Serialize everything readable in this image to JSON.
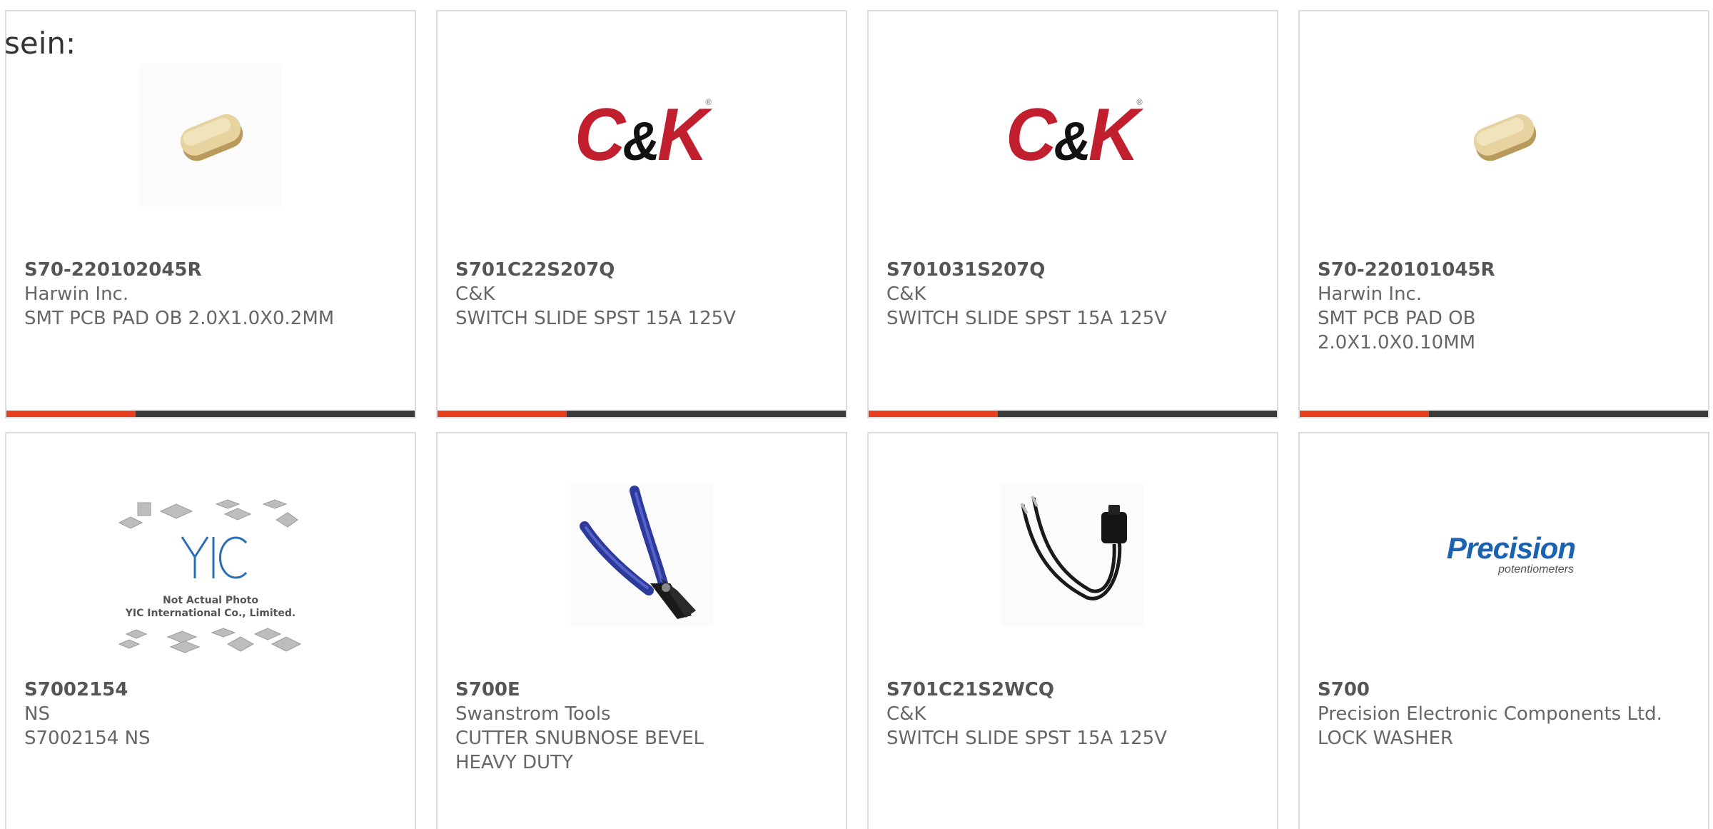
{
  "overlay_text": "sein:",
  "products": [
    {
      "part_number": "S70-220102045R",
      "manufacturer": "Harwin Inc.",
      "description": "SMT PCB PAD OB 2.0X1.0X0.2MM",
      "image_icon": "gold-pad-icon"
    },
    {
      "part_number": "S701C22S207Q",
      "manufacturer": "C&K",
      "description": "SWITCH SLIDE SPST 15A 125V",
      "image_icon": "ck-logo",
      "logo_text": "C&K"
    },
    {
      "part_number": "S701031S207Q",
      "manufacturer": "C&K",
      "description": "SWITCH SLIDE SPST 15A 125V",
      "image_icon": "ck-logo",
      "logo_text": "C&K"
    },
    {
      "part_number": "S70-220101045R",
      "manufacturer": "Harwin Inc.",
      "description": "SMT PCB PAD OB 2.0X1.0X0.10MM",
      "image_icon": "gold-pad-icon"
    },
    {
      "part_number": "S7002154",
      "manufacturer": "NS",
      "description": "S7002154 NS",
      "image_icon": "yic-placeholder",
      "logo_text": "YIC",
      "note_line1": "Not Actual Photo",
      "note_line2": "YIC International Co., Limited."
    },
    {
      "part_number": "S700E",
      "manufacturer": "Swanstrom Tools",
      "description": "CUTTER SNUBNOSE BEVEL HEAVY DUTY",
      "image_icon": "cutter-icon"
    },
    {
      "part_number": "S701C21S2WCQ",
      "manufacturer": "C&K",
      "description": "SWITCH SLIDE SPST 15A 125V",
      "image_icon": "wired-switch-icon"
    },
    {
      "part_number": "S700",
      "manufacturer": "Precision Electronic Components Ltd.",
      "description": "LOCK WASHER",
      "image_icon": "precision-logo",
      "logo_text": "Precision",
      "logo_subtext": "potentiometers"
    }
  ],
  "colors": {
    "accent": "#e8401c",
    "bar": "#3b3b3b",
    "ck_red": "#c21f2e",
    "precision_blue": "#1a63b0",
    "border": "#dcdcdc"
  },
  "card_progress_fraction": 0.316
}
